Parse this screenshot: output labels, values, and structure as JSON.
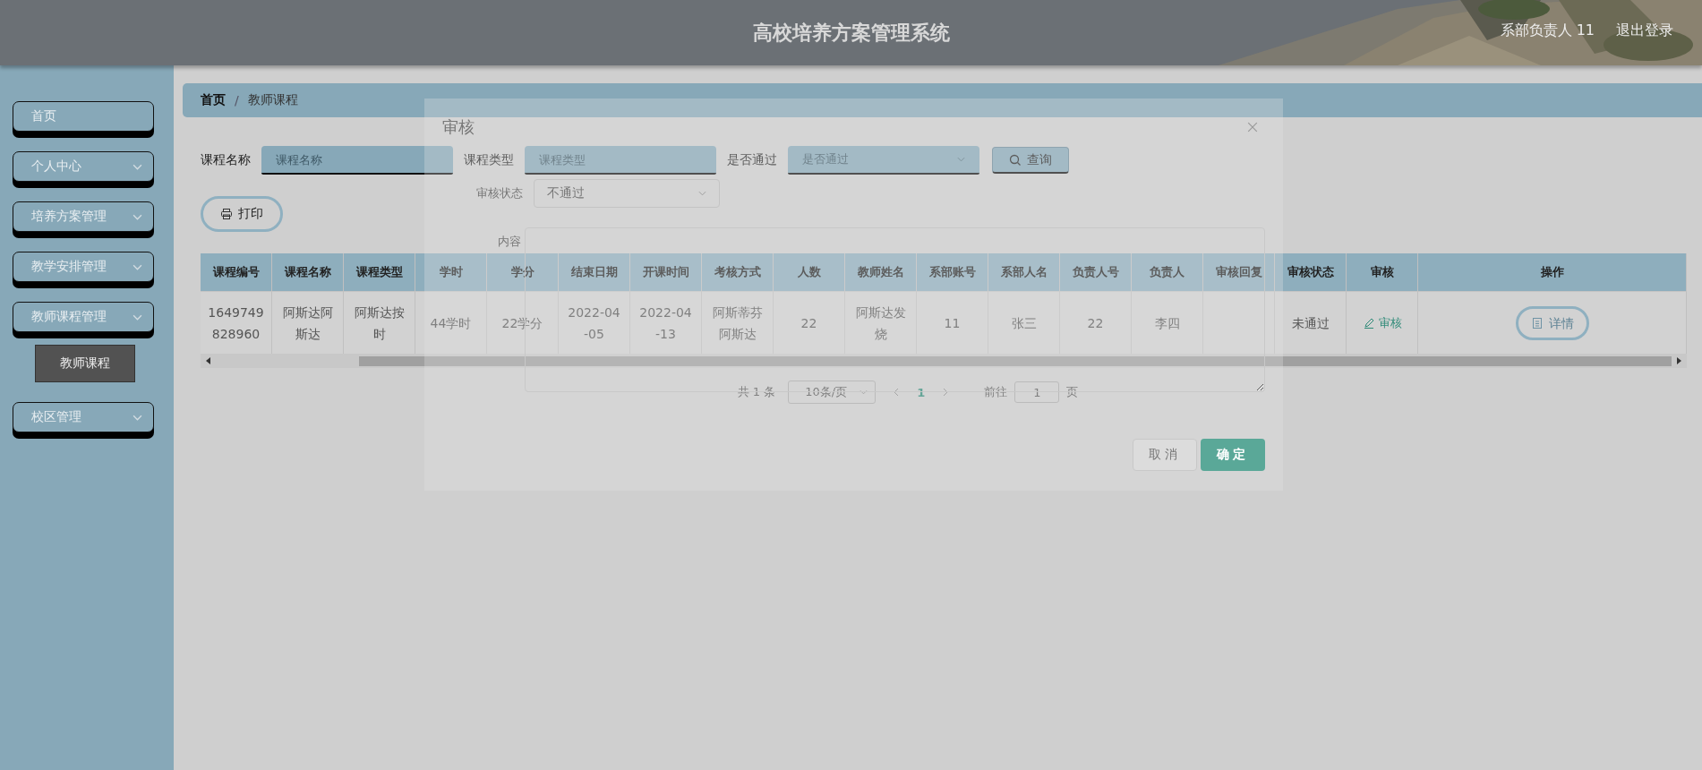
{
  "header": {
    "title": "高校培养方案管理系统",
    "user": "系部负责人 11",
    "logout": "退出登录"
  },
  "sidebar": {
    "items": [
      {
        "label": "首页",
        "kind": "link"
      },
      {
        "label": "个人中心",
        "kind": "menu"
      },
      {
        "label": "培养方案管理",
        "kind": "menu"
      },
      {
        "label": "教学安排管理",
        "kind": "menu"
      },
      {
        "label": "教师课程管理",
        "kind": "menu",
        "children": [
          {
            "label": "教师课程",
            "selected": true
          }
        ]
      },
      {
        "label": "校区管理",
        "kind": "menu"
      }
    ]
  },
  "breadcrumb": {
    "separator": "/",
    "items": [
      {
        "label": "首页"
      },
      {
        "label": "教师课程"
      }
    ]
  },
  "search": {
    "fields": [
      {
        "label": "课程名称",
        "placeholder": "课程名称",
        "kind": "text"
      },
      {
        "label": "课程类型",
        "placeholder": "课程类型",
        "kind": "text"
      },
      {
        "label": "是否通过",
        "placeholder": "是否通过",
        "kind": "select"
      }
    ],
    "button": "查询"
  },
  "print_button": "打印",
  "table": {
    "columns": [
      "课程编号",
      "课程名称",
      "课程类型",
      "学时",
      "学分",
      "结束日期",
      "开课时间",
      "考核方式",
      "人数",
      "教师姓名",
      "系部账号",
      "系部人名",
      "负责人号",
      "负责人",
      "审核回复",
      "审核状态",
      "审核",
      "操作"
    ],
    "rows": [
      {
        "cells": [
          "1649749828960",
          "阿斯达阿斯达",
          "阿斯达按时",
          "44学时",
          "22学分",
          "2022-04-05",
          "2022-04-13",
          "阿斯蒂芬阿斯达",
          "22",
          "阿斯达发烧",
          "11",
          "张三",
          "22",
          "李四",
          null,
          "未通过"
        ],
        "review": "审核",
        "detail": "详情"
      }
    ]
  },
  "pagination": {
    "total": "共 1 条",
    "page_size": "10条/页",
    "pages": [
      {
        "label": "1",
        "selected": true
      }
    ],
    "goto_label": "前往",
    "goto_value": "1",
    "goto_suffix": "页"
  },
  "dialog": {
    "title": "审核",
    "status_label": "审核状态",
    "status_value": "不通过",
    "content_label": "内容",
    "cancel": "取消",
    "confirm": "确定"
  }
}
